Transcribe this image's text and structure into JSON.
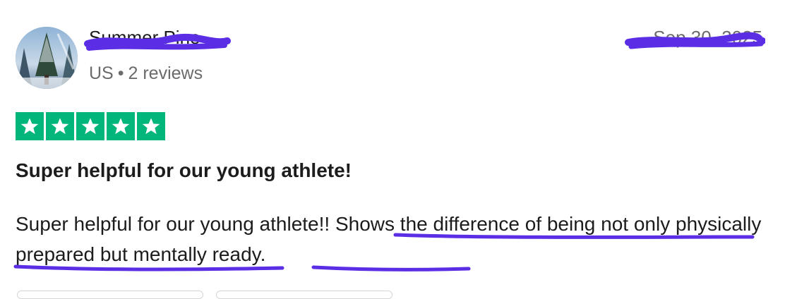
{
  "reviewer": {
    "name": "Summer Pine",
    "country": "US",
    "separator": "•",
    "review_count": "2 reviews",
    "avatar_icon": "avatar-photo-snowy-trees"
  },
  "review": {
    "date": "Sep 30, 2025",
    "rating": 5,
    "max_rating": 5,
    "star_color": "#00b67a",
    "title": "Super helpful for our young athlete!",
    "body_part1": "Super helpful for our young athlete!! ",
    "body_part2": "Shows the difference of being not only physically prepared but mentally ready."
  },
  "annotations": {
    "marker_color": "#5b2ee6"
  }
}
